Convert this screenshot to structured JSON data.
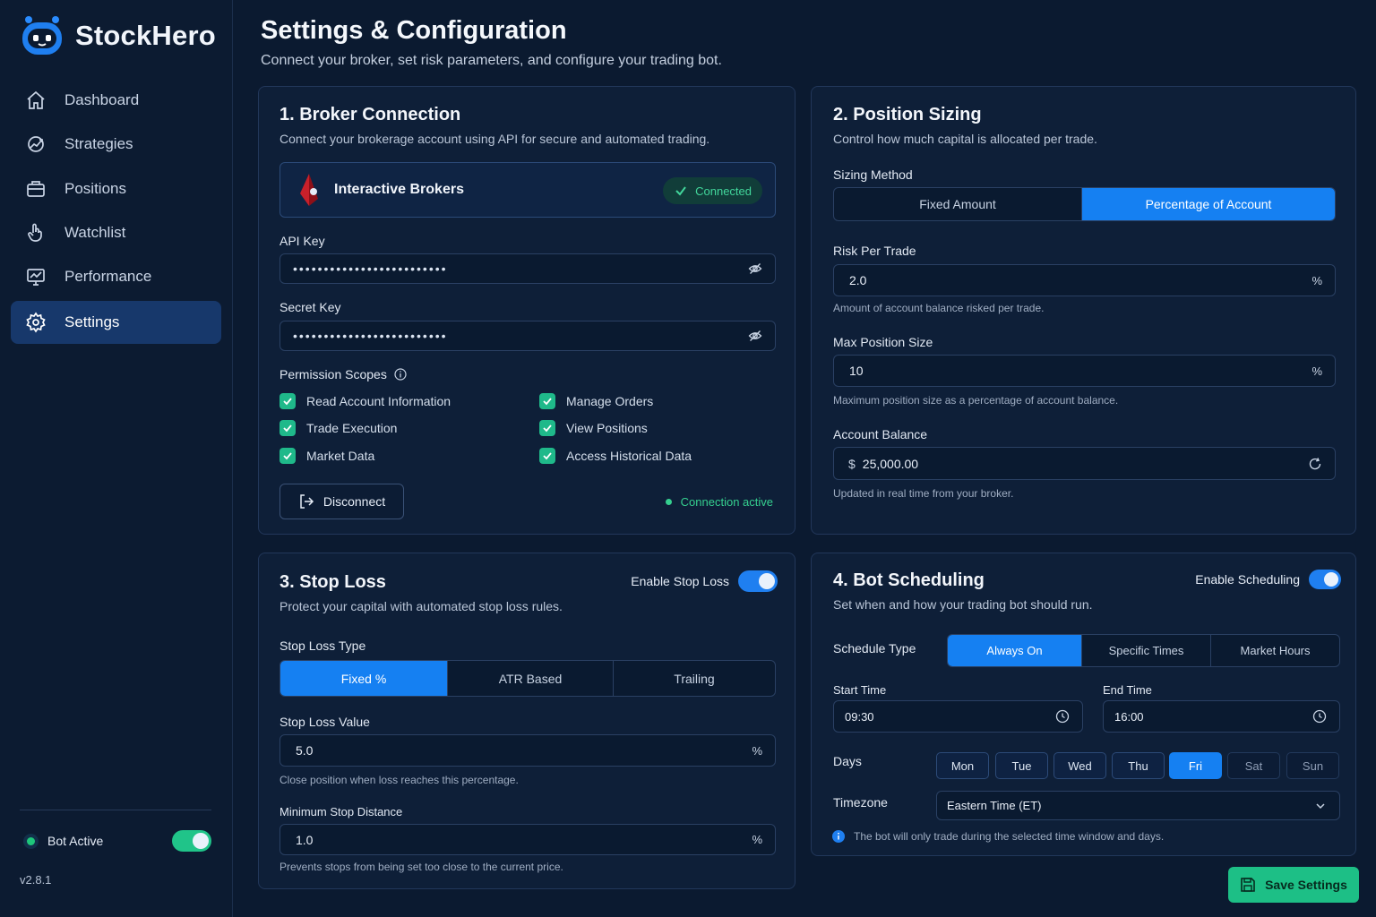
{
  "app": {
    "name": "StockHero",
    "version": "v2.8.1",
    "bot_status_label": "Bot Active",
    "bot_active": true
  },
  "sidebar": {
    "items": [
      {
        "label": "Dashboard",
        "icon": "home-icon"
      },
      {
        "label": "Strategies",
        "icon": "strategy-icon"
      },
      {
        "label": "Positions",
        "icon": "briefcase-icon"
      },
      {
        "label": "Watchlist",
        "icon": "hand-icon"
      },
      {
        "label": "Performance",
        "icon": "chart-monitor-icon"
      },
      {
        "label": "Settings",
        "icon": "gear-icon",
        "active": true
      }
    ]
  },
  "header": {
    "title": "Settings & Configuration",
    "subtitle": "Connect your broker, set risk parameters, and configure your trading bot."
  },
  "broker": {
    "title": "1.  Broker  Connection",
    "subtitle": "Connect your brokerage account using API for secure and automated trading.",
    "broker_name": "Interactive Brokers",
    "status": "Connected",
    "api_key_label": "API Key",
    "api_key_value": "•••••••••••••••••••••••••",
    "secret_key_label": "Secret Key",
    "secret_key_value": "•••••••••••••••••••••••••",
    "permissions_label": "Permission Scopes",
    "permissions": [
      {
        "label": "Read Account Information",
        "checked": true
      },
      {
        "label": "Manage Orders",
        "checked": true
      },
      {
        "label": "Trade Execution",
        "checked": true
      },
      {
        "label": "View Positions",
        "checked": true
      },
      {
        "label": "Market Data",
        "checked": true
      },
      {
        "label": "Access Historical Data",
        "checked": true
      }
    ],
    "disconnect_label": "Disconnect",
    "connection_status": "Connection active"
  },
  "position_sizing": {
    "title": "2.  Position Sizing",
    "subtitle": "Control how much capital is allocated per trade.",
    "method_label": "Sizing Method",
    "methods": [
      "Fixed Amount",
      "Percentage of Account"
    ],
    "selected_method": "Percentage of Account",
    "risk_label": "Risk Per Trade",
    "risk_value": "2.0",
    "risk_suffix": "%",
    "risk_hint": "Amount of account balance risked per trade.",
    "max_label": "Max Position Size",
    "max_value": "10",
    "max_suffix": "%",
    "max_hint": "Maximum position size as a percentage of account balance.",
    "balance_label": "Account Balance",
    "balance_prefix": "$",
    "balance_value": "25,000.00",
    "balance_hint": "Updated in real time from your broker."
  },
  "stop_loss": {
    "title": "3.  Stop Loss",
    "subtitle": "Protect your capital with automated stop loss rules.",
    "enable_label": "Enable Stop Loss",
    "enabled": true,
    "type_label": "Stop Loss Type",
    "types": [
      "Fixed %",
      "ATR Based",
      "Trailing"
    ],
    "selected_type": "Fixed %",
    "value_label": "Stop Loss Value",
    "value": "5.0",
    "value_suffix": "%",
    "value_hint": "Close position when loss reaches this percentage.",
    "min_label": "Minimum Stop Distance",
    "min_value": "1.0",
    "min_suffix": "%",
    "min_hint": "Prevents stops from being set too close to the current price."
  },
  "scheduling": {
    "title": "4.  Bot Scheduling",
    "subtitle": "Set when and how your trading bot should run.",
    "enable_label": "Enable Scheduling",
    "enabled": true,
    "type_label": "Schedule Type",
    "types": [
      "Always On",
      "Specific Times",
      "Market Hours"
    ],
    "selected_type": "Always On",
    "start_label": "Start Time",
    "start_value": "09:30",
    "end_label": "End Time",
    "end_value": "16:00",
    "days_label": "Days",
    "days": [
      {
        "label": "Mon",
        "state": "normal"
      },
      {
        "label": "Tue",
        "state": "normal"
      },
      {
        "label": "Wed",
        "state": "normal"
      },
      {
        "label": "Thu",
        "state": "normal"
      },
      {
        "label": "Fri",
        "state": "selected"
      },
      {
        "label": "Sat",
        "state": "disabled"
      },
      {
        "label": "Sun",
        "state": "disabled"
      }
    ],
    "timezone_label": "Timezone",
    "timezone_value": "Eastern Time (ET)",
    "note": "The bot will only trade during the selected time window and days."
  },
  "actions": {
    "save_label": "Save Settings"
  },
  "colors": {
    "accent": "#1580f2",
    "success": "#1dbf86",
    "background": "#0b1a30",
    "card": "#0e1f38"
  }
}
